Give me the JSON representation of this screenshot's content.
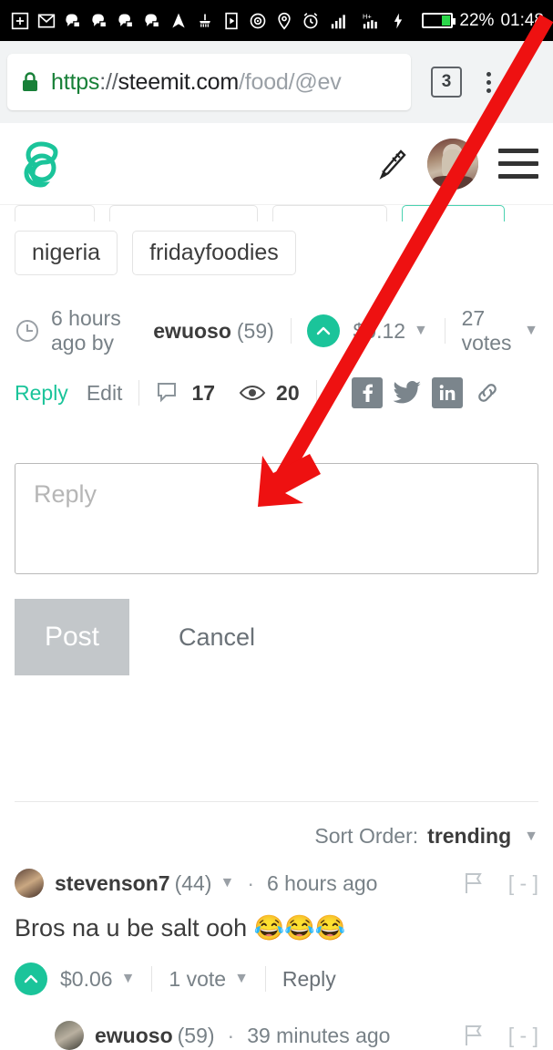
{
  "statusbar": {
    "icons": [
      "plus-box-icon",
      "gmail-icon",
      "chat-icon-1",
      "chat-icon-2",
      "chat-icon-3",
      "chat-icon-4",
      "navigation-arrow-icon",
      "broom-icon",
      "play-box-icon",
      "cast-icon",
      "location-pin-icon",
      "alarm-clock-icon",
      "signal-bars-icon",
      "hplus-signal-icon",
      "charging-bolt-icon"
    ],
    "battery_percent": "22%",
    "time": "01:48",
    "battery_fill_color": "#2bd74a"
  },
  "browser": {
    "url_scheme": "https",
    "url_separator": "://",
    "url_host": "steemit.com",
    "url_path": "/food/@ev",
    "tab_count": "3",
    "lock_color": "#188038"
  },
  "site_header": {
    "logo_name": "steemit-logo",
    "logo_color": "#1bc49a",
    "pen_icon": "pen-compose-icon",
    "avatar": "user-avatar",
    "menu": "hamburger-menu-icon"
  },
  "post": {
    "tags_clipped": [
      "",
      "",
      ""
    ],
    "tags": [
      "nigeria",
      "fridayfoodies"
    ],
    "time_ago": "6 hours ago by",
    "author": "ewuoso",
    "reputation": "(59)",
    "payout": "$0.12",
    "votes": "27 votes",
    "reply_label": "Reply",
    "edit_label": "Edit",
    "comment_count": "17",
    "view_count": "20",
    "share": [
      "facebook-icon",
      "twitter-icon",
      "linkedin-icon",
      "link-icon"
    ]
  },
  "composer": {
    "placeholder": "Reply",
    "value": "",
    "post_label": "Post",
    "cancel_label": "Cancel"
  },
  "comments_section": {
    "sort_label": "Sort Order:",
    "sort_value": "trending",
    "comments": [
      {
        "author": "stevenson7",
        "reputation": "(44)",
        "separator": "·",
        "time_ago": "6 hours ago",
        "collapse": "[ - ]",
        "body": "Bros na u be salt ooh",
        "emojis": "😂😂😂",
        "payout": "$0.06",
        "votes": "1 vote",
        "reply_label": "Reply"
      },
      {
        "author": "ewuoso",
        "reputation": "(59)",
        "separator": "·",
        "time_ago": "39 minutes ago",
        "collapse": "[ - ]"
      }
    ]
  },
  "annotation": {
    "arrow_color": "#ee1111",
    "points_to": "reply-textarea"
  }
}
